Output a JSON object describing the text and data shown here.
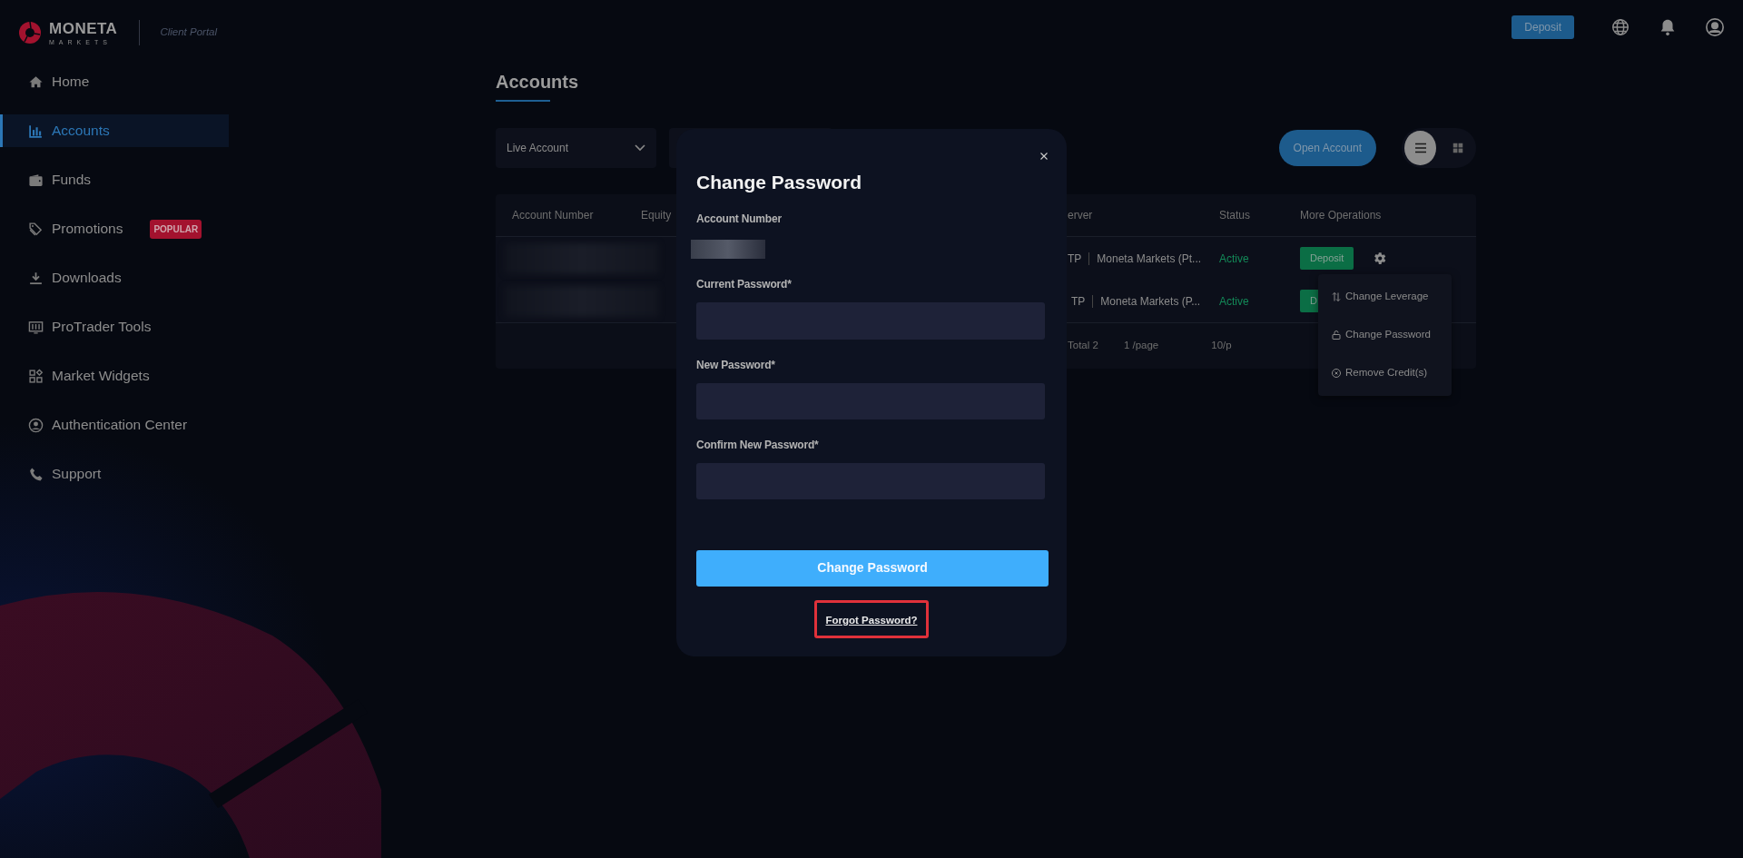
{
  "brand": {
    "name": "MONETA",
    "sub": "MARKETS",
    "portal": "Client Portal"
  },
  "header": {
    "deposit": "Deposit"
  },
  "sidebar": {
    "items": [
      {
        "label": "Home",
        "selected": false
      },
      {
        "label": "Accounts",
        "selected": true
      },
      {
        "label": "Funds",
        "selected": false
      },
      {
        "label": "Promotions",
        "selected": false,
        "badge": "POPULAR"
      },
      {
        "label": "Downloads",
        "selected": false
      },
      {
        "label": "ProTrader Tools",
        "selected": false
      },
      {
        "label": "Market Widgets",
        "selected": false
      },
      {
        "label": "Authentication Center",
        "selected": false
      },
      {
        "label": "Support",
        "selected": false
      }
    ]
  },
  "page": {
    "title": "Accounts",
    "filter": "Live Account",
    "open_account": "Open Account",
    "view_toggle": [
      {
        "kind": "list",
        "selected": true
      },
      {
        "kind": "grid",
        "selected": false
      }
    ]
  },
  "table": {
    "columns": [
      "Account Number",
      "Equity",
      "erver",
      "Status",
      "More Operations"
    ],
    "rows": [
      {
        "platform": "TP",
        "server": "Moneta Markets (Pt...",
        "status": "Active",
        "action": "Deposit"
      },
      {
        "platform": "TP",
        "server": "Moneta Markets (P...",
        "status": "Active",
        "action": "D"
      }
    ],
    "footer": {
      "total": "Total 2",
      "page_size": "1 /page",
      "per_page": "10/p"
    }
  },
  "menu": {
    "items": [
      {
        "label": "Change Leverage"
      },
      {
        "label": "Change Password"
      },
      {
        "label": "Remove Credit(s)"
      }
    ]
  },
  "modal": {
    "title": "Change Password",
    "account_label": "Account Number",
    "fields": [
      {
        "label": "Current Password*"
      },
      {
        "label": "New Password*"
      },
      {
        "label": "Confirm New Password*"
      }
    ],
    "submit": "Change Password",
    "forgot": {
      "text": "Forgot Password?",
      "highlighted": true
    }
  }
}
